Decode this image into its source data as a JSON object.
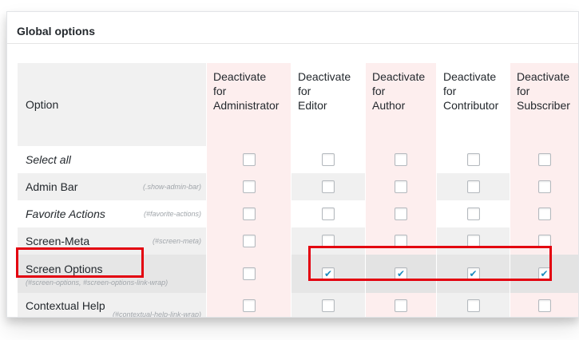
{
  "panel": {
    "title": "Global options"
  },
  "columns": {
    "option": "Option",
    "roles": [
      [
        "Deactivate",
        "for",
        "Administrator"
      ],
      [
        "Deactivate",
        "for",
        "Editor"
      ],
      [
        "Deactivate",
        "for",
        "Author"
      ],
      [
        "Deactivate",
        "for",
        "Contributor"
      ],
      [
        "Deactivate",
        "for",
        "Subscriber"
      ]
    ]
  },
  "rows": [
    {
      "label": "Select all",
      "italic": true,
      "selector": "",
      "checked": [
        false,
        false,
        false,
        false,
        false
      ]
    },
    {
      "label": "Admin Bar",
      "italic": false,
      "selector": "(.show-admin-bar)",
      "checked": [
        false,
        false,
        false,
        false,
        false
      ]
    },
    {
      "label": "Favorite Actions",
      "italic": true,
      "selector": "(#favorite-actions)",
      "checked": [
        false,
        false,
        false,
        false,
        false
      ]
    },
    {
      "label": "Screen-Meta",
      "italic": false,
      "selector": "(#screen-meta)",
      "checked": [
        false,
        false,
        false,
        false,
        false
      ]
    },
    {
      "label": "Screen Options",
      "italic": false,
      "selector": "(#screen-options, #screen-options-link-wrap)",
      "checked": [
        false,
        true,
        true,
        true,
        true
      ]
    },
    {
      "label": "Contextual Help",
      "italic": false,
      "selector": "(#contextual-help-link-wrap)",
      "checked": [
        false,
        false,
        false,
        false,
        false
      ]
    }
  ],
  "colors": {
    "highlight": "#e3000f",
    "role_tint": "#fdeeee",
    "checkmark": "#1e8cbe"
  }
}
